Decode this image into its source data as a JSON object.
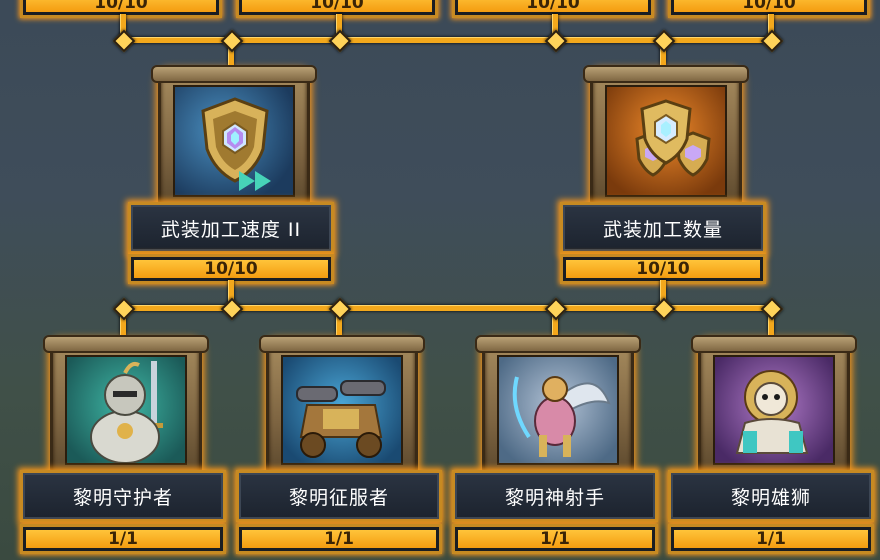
{
  "top_row": [
    {
      "progress": "10/10",
      "fill": 1.0
    },
    {
      "progress": "10/10",
      "fill": 1.0
    },
    {
      "progress": "10/10",
      "fill": 1.0
    },
    {
      "progress": "10/10",
      "fill": 1.0
    }
  ],
  "middle_nodes": [
    {
      "name": "武装加工速度 II",
      "progress": "10/10",
      "fill": 1.0,
      "icon": "shield-speed-icon"
    },
    {
      "name": "武装加工数量",
      "progress": "10/10",
      "fill": 1.0,
      "icon": "shields-quantity-icon"
    }
  ],
  "bottom_nodes": [
    {
      "name": "黎明守护者",
      "progress": "1/1",
      "fill": 1.0,
      "icon": "armored-knight-icon"
    },
    {
      "name": "黎明征服者",
      "progress": "1/1",
      "fill": 1.0,
      "icon": "siege-cannon-icon"
    },
    {
      "name": "黎明神射手",
      "progress": "1/1",
      "fill": 1.0,
      "icon": "winged-archer-icon"
    },
    {
      "name": "黎明雄狮",
      "progress": "1/1",
      "fill": 1.0,
      "icon": "armored-lion-icon"
    }
  ],
  "colors": {
    "accent": "#f3a81c",
    "glow": "#ff9a1a",
    "name_bg": "#1c232e"
  }
}
